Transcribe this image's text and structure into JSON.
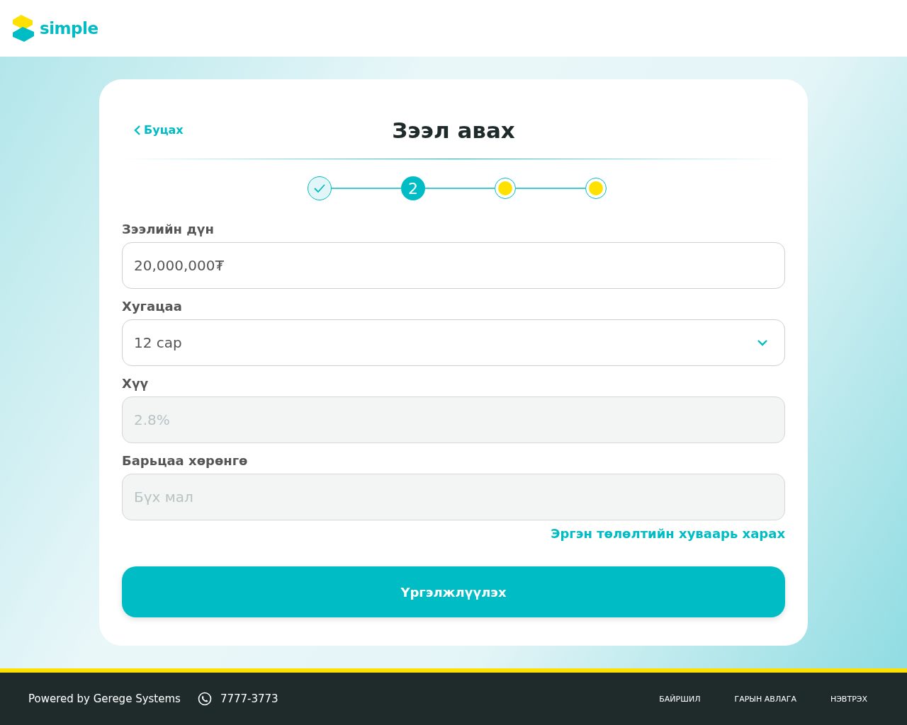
{
  "header": {
    "logo_text": "simple"
  },
  "card": {
    "back_link": "Буцах",
    "title": "Зээл авах",
    "steps": [
      {
        "kind": "done"
      },
      {
        "kind": "current",
        "label": "2"
      },
      {
        "kind": "pending"
      },
      {
        "kind": "pending"
      }
    ],
    "fields": [
      {
        "kind": "input",
        "label": "Зээлийн дүн",
        "value": "20,000,000₮",
        "disabled": false
      },
      {
        "kind": "select",
        "label": "Хугацаа",
        "value": "12 сар",
        "disabled": false
      },
      {
        "kind": "input",
        "label": "Хүү",
        "placeholder": "2.8%",
        "disabled": true
      },
      {
        "kind": "input",
        "label": "Барьцаа хөрөнгө",
        "placeholder": "Бүх мал",
        "disabled": true
      }
    ],
    "schedule_link": "Эргэн төлөлтийн хуваарь харах",
    "continue_button": "Үргэлжлүүлэх"
  },
  "footer": {
    "powered_by": "Powered by Gerege Systems",
    "phone": "7777-3773",
    "links": [
      "БАЙРШИЛ",
      "ГАРЫН АВЛАГА",
      "НЭВТРЭХ"
    ]
  }
}
